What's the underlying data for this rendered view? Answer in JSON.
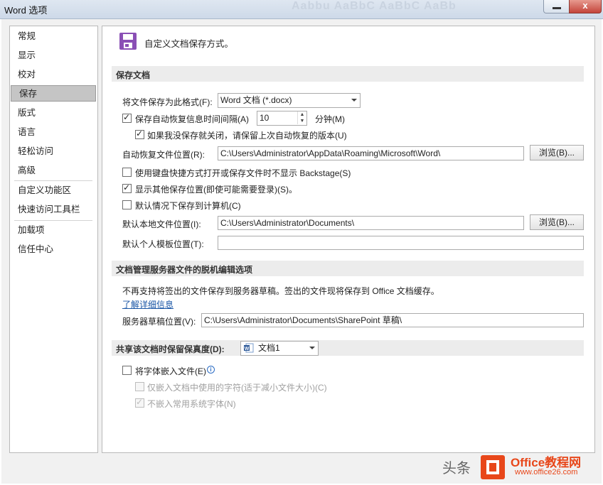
{
  "window": {
    "title": "Word 选项",
    "close_label": "x",
    "bg_ghost": "Aabbu AaBbC AaBbC AaBb"
  },
  "nav": {
    "items": [
      "常规",
      "显示",
      "校对",
      "保存",
      "版式",
      "语言",
      "轻松访问",
      "高级",
      "自定义功能区",
      "快速访问工具栏",
      "加载项",
      "信任中心"
    ],
    "selected": "保存"
  },
  "header": {
    "text": "自定义文档保存方式。",
    "icon": "save-disk-icon"
  },
  "save_section": {
    "title": "保存文档",
    "format_label": "将文件保存为此格式(F):",
    "format_value": "Word 文档 (*.docx)",
    "autorecover_label": "保存自动恢复信息时间间隔(A)",
    "autorecover_checked": true,
    "autorecover_minutes": "10",
    "minutes_label": "分钟(M)",
    "keep_version_label": "如果我没保存就关闭，请保留上次自动恢复的版本(U)",
    "keep_version_checked": true,
    "autorecover_location_label": "自动恢复文件位置(R):",
    "autorecover_location_value": "C:\\Users\\Administrator\\AppData\\Roaming\\Microsoft\\Word\\",
    "browse1": "浏览(B)...",
    "no_backstage_label": "使用键盘快捷方式打开或保存文件时不显示 Backstage(S)",
    "no_backstage_checked": false,
    "show_locations_label": "显示其他保存位置(即使可能需要登录)(S)。",
    "show_locations_checked": true,
    "save_to_computer_label": "默认情况下保存到计算机(C)",
    "save_to_computer_checked": false,
    "local_location_label": "默认本地文件位置(I):",
    "local_location_value": "C:\\Users\\Administrator\\Documents\\",
    "browse2": "浏览(B)...",
    "template_location_label": "默认个人模板位置(T):",
    "template_location_value": ""
  },
  "offline_section": {
    "title": "文档管理服务器文件的脱机编辑选项",
    "notice": "不再支持将签出的文件保存到服务器草稿。签出的文件现将保存到 Office 文档缓存。",
    "learn_more": "了解详细信息",
    "drafts_label": "服务器草稿位置(V):",
    "drafts_value": "C:\\Users\\Administrator\\Documents\\SharePoint 草稿\\"
  },
  "fidelity_section": {
    "title": "共享该文档时保留保真度(D):",
    "doc_value": "文档1",
    "embed_fonts_label": "将字体嵌入文件(E)",
    "embed_fonts_checked": false,
    "embed_used_label": "仅嵌入文档中使用的字符(适于减小文件大小)(C)",
    "embed_used_checked": false,
    "no_common_label": "不嵌入常用系统字体(N)",
    "no_common_checked": true
  },
  "watermark": {
    "text1": "头条",
    "text2": "Office教程网",
    "text3": "www.office26.com"
  },
  "colors": {
    "accent_purple": "#8a4fb5",
    "office_orange": "#e8471a"
  }
}
